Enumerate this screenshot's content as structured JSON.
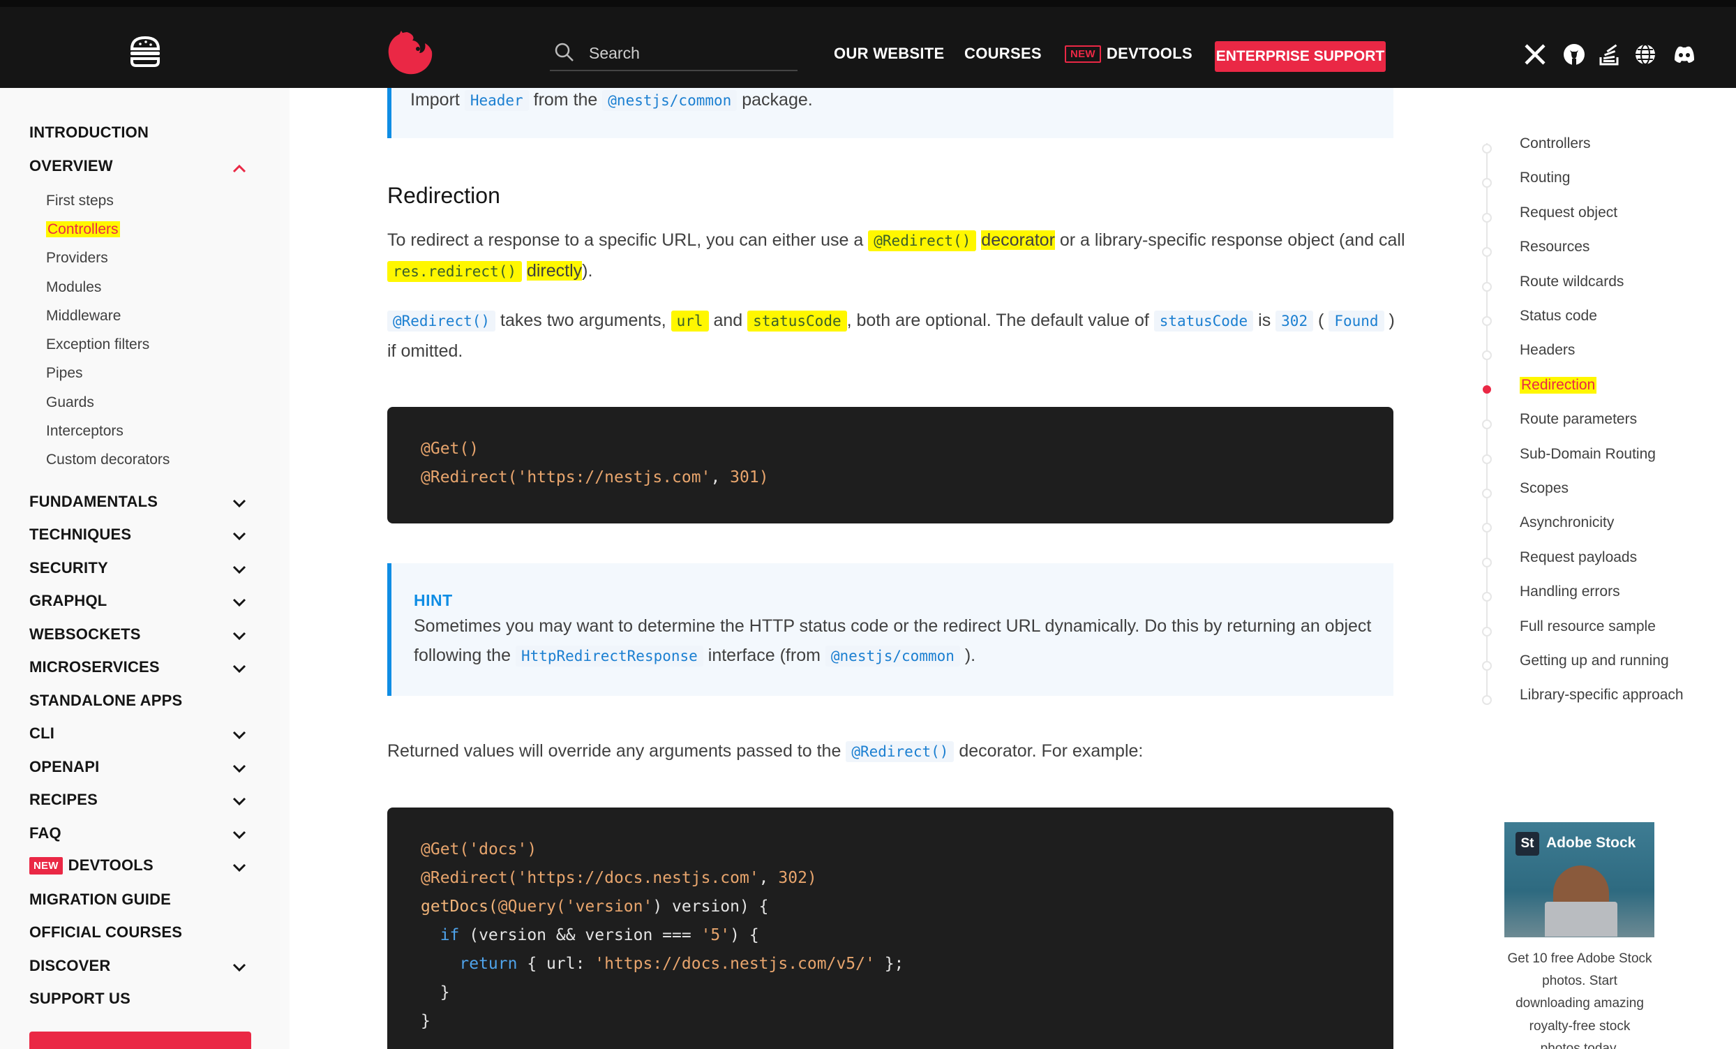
{
  "header": {
    "search_placeholder": "Search",
    "nav": {
      "our_website": "OUR WEBSITE",
      "courses": "COURSES",
      "new_badge": "NEW",
      "devtools": "DEVTOOLS",
      "enterprise": "ENTERPRISE SUPPORT"
    },
    "social_icons": [
      "x-icon",
      "github-icon",
      "stackoverflow-icon",
      "globe-icon",
      "discord-icon"
    ]
  },
  "sidebar": {
    "intro": "INTRODUCTION",
    "overview": "OVERVIEW",
    "overview_items": [
      "First steps",
      "Controllers",
      "Providers",
      "Modules",
      "Middleware",
      "Exception filters",
      "Pipes",
      "Guards",
      "Interceptors",
      "Custom decorators"
    ],
    "sections": [
      "FUNDAMENTALS",
      "TECHNIQUES",
      "SECURITY",
      "GRAPHQL",
      "WEBSOCKETS",
      "MICROSERVICES",
      "STANDALONE APPS",
      "CLI",
      "OPENAPI",
      "RECIPES",
      "FAQ",
      "DEVTOOLS",
      "MIGRATION GUIDE",
      "OFFICIAL COURSES",
      "DISCOVER",
      "SUPPORT US"
    ],
    "new_badge": "NEW"
  },
  "content": {
    "top_callout": {
      "t1": "Import",
      "c1": "Header",
      "t2": "from the",
      "c2": "@nestjs/common",
      "t3": "package."
    },
    "heading": "Redirection",
    "p1": {
      "t1": "To redirect a response to a specific URL, you can either use a",
      "c1": "@Redirect()",
      "t2": "decorator",
      "t3": "or a library-specific response object (and call",
      "c2": "res.redirect()",
      "t4": "directly",
      "t5": ")."
    },
    "p2": {
      "c1": "@Redirect()",
      "t1": "takes two arguments,",
      "c2": "url",
      "t2": "and",
      "c3": "statusCode",
      "t3": ", both are optional. The default value of",
      "c4": "statusCode",
      "t4": "is",
      "c5": "302",
      "t5": "(",
      "c6": "Found",
      "t6": ")",
      "t7": "if omitted."
    },
    "code1": {
      "l1_dec": "@Get()",
      "l2_dec": "@Redirect(",
      "l2_str": "'https://nestjs.com'",
      "l2_sep": ", ",
      "l2_num": "301",
      "l2_end": ")"
    },
    "hint": {
      "title": "HINT",
      "line1": "Sometimes you may want to determine the HTTP status code or the redirect URL dynamically. Do this by returning an object",
      "t1": "following the",
      "c1": "HttpRedirectResponse",
      "t2": "interface (from",
      "c2": "@nestjs/common",
      "t3": ")."
    },
    "p3": {
      "t1": "Returned values will override any arguments passed to the",
      "c1": "@Redirect()",
      "t2": "decorator. For example:"
    },
    "code2": {
      "l1a": "@Get(",
      "l1b": "'docs'",
      "l1c": ")",
      "l2a": "@Redirect(",
      "l2b": "'https://docs.nestjs.com'",
      "l2c": ", ",
      "l2d": "302",
      "l2e": ")",
      "l3a": "getDocs(",
      "l3b": "@Query(",
      "l3c": "'version'",
      "l3d": ") version) {",
      "l4a": "  if",
      "l4b": " (version && version === ",
      "l4c": "'5'",
      "l4d": ") {",
      "l5a": "    return",
      "l5b": " { url: ",
      "l5c": "'https://docs.nestjs.com/v5/'",
      "l5d": " };",
      "l6": "  }",
      "l7": "}"
    }
  },
  "toc": {
    "items": [
      "Controllers",
      "Routing",
      "Request object",
      "Resources",
      "Route wildcards",
      "Status code",
      "Headers",
      "Redirection",
      "Route parameters",
      "Sub-Domain Routing",
      "Scopes",
      "Asynchronicity",
      "Request payloads",
      "Handling errors",
      "Full resource sample",
      "Getting up and running",
      "Library-specific approach"
    ],
    "active_index": 7
  },
  "ad": {
    "badge": "St",
    "brand": "Adobe Stock",
    "lines": [
      "Get 10 free Adobe Stock",
      "photos. Start",
      "downloading amazing",
      "royalty-free stock",
      "photos today."
    ]
  },
  "colors": {
    "brand_red": "#ea2845",
    "link_blue": "#0f8de4",
    "highlight": "#fff700",
    "topbar": "#151515"
  }
}
